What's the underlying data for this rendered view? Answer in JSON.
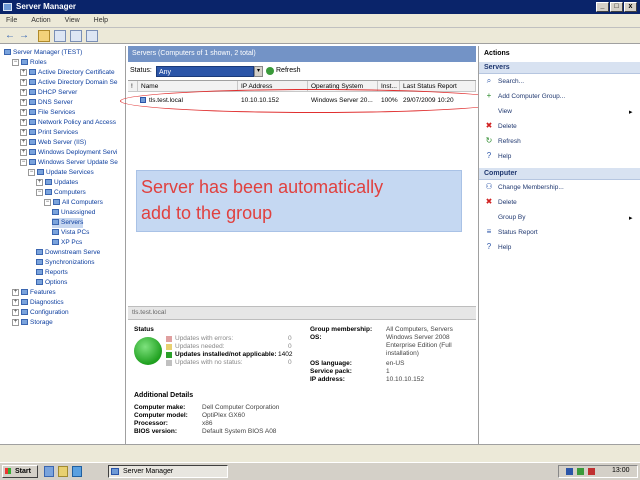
{
  "window": {
    "title": "Server Manager",
    "min": "_",
    "max": "□",
    "close": "x"
  },
  "menu": [
    "File",
    "Action",
    "View",
    "Help"
  ],
  "toolbar": {
    "back": "←",
    "forward": "→"
  },
  "tree": [
    {
      "label": "Server Manager (TEST)",
      "indent": 0,
      "exp": "",
      "icon": true
    },
    {
      "label": "Roles",
      "indent": 1,
      "exp": "−"
    },
    {
      "label": "Active Directory Certificate",
      "indent": 2,
      "exp": "+"
    },
    {
      "label": "Active Directory Domain Se",
      "indent": 2,
      "exp": "+"
    },
    {
      "label": "DHCP Server",
      "indent": 2,
      "exp": "+"
    },
    {
      "label": "DNS Server",
      "indent": 2,
      "exp": "+"
    },
    {
      "label": "File Services",
      "indent": 2,
      "exp": "+"
    },
    {
      "label": "Network Policy and Access",
      "indent": 2,
      "exp": "+"
    },
    {
      "label": "Print Services",
      "indent": 2,
      "exp": "+"
    },
    {
      "label": "Web Server (IIS)",
      "indent": 2,
      "exp": "+"
    },
    {
      "label": "Windows Deployment Servi",
      "indent": 2,
      "exp": "+"
    },
    {
      "label": "Windows Server Update Se",
      "indent": 2,
      "exp": "−"
    },
    {
      "label": "Update Services",
      "indent": 3,
      "exp": "−"
    },
    {
      "label": "Updates",
      "indent": 4,
      "exp": "+"
    },
    {
      "label": "Computers",
      "indent": 4,
      "exp": "−"
    },
    {
      "label": "All Computers",
      "indent": 5,
      "exp": "−"
    },
    {
      "label": "Unassigned",
      "indent": 6,
      "exp": ""
    },
    {
      "label": "Servers",
      "indent": 6,
      "exp": "",
      "sel": true
    },
    {
      "label": "Vista PCs",
      "indent": 6,
      "exp": ""
    },
    {
      "label": "XP Pcs",
      "indent": 6,
      "exp": ""
    },
    {
      "label": "Downstream Serve",
      "indent": 4,
      "exp": ""
    },
    {
      "label": "Synchronizations",
      "indent": 4,
      "exp": ""
    },
    {
      "label": "Reports",
      "indent": 4,
      "exp": ""
    },
    {
      "label": "Options",
      "indent": 4,
      "exp": ""
    },
    {
      "label": "Features",
      "indent": 1,
      "exp": "+"
    },
    {
      "label": "Diagnostics",
      "indent": 1,
      "exp": "+"
    },
    {
      "label": "Configuration",
      "indent": 1,
      "exp": "+"
    },
    {
      "label": "Storage",
      "indent": 1,
      "exp": "+"
    }
  ],
  "center": {
    "header": "Servers (Computers of 1 shown, 2 total)",
    "status_label": "Status:",
    "status_value": "Any",
    "refresh": "Refresh",
    "columns": [
      "!",
      "Name",
      "IP Address",
      "Operating System",
      "Inst...",
      "Last Status Report"
    ],
    "row": [
      "",
      "tls.test.local",
      "10.10.10.152",
      "Windows Server 20...",
      "100%",
      "29/07/2009 10:20"
    ]
  },
  "callout": {
    "line1": "Server has been automatically",
    "line2": "add to the group"
  },
  "details": {
    "heading": "tls.test.local",
    "status_title": "Status",
    "status_items": [
      {
        "label": "Updates with errors:",
        "value": "0"
      },
      {
        "label": "Updates needed:",
        "value": "0"
      },
      {
        "label": "Updates installed/not applicable:",
        "value": "1402"
      },
      {
        "label": "Updates with no status:",
        "value": "0"
      }
    ],
    "group_label": "Group membership:",
    "group_value": "All Computers, Servers",
    "os_label": "OS:",
    "os_value": [
      "Windows Server 2008",
      "Enterprise Edition (Full",
      "installation)"
    ],
    "lang_label": "OS language:",
    "lang_value": "en-US",
    "sp_label": "Service pack:",
    "sp_value": "1",
    "ip_label": "IP address:",
    "ip_value": "10.10.10.152",
    "additional_title": "Additional Details",
    "make_label": "Computer make:",
    "make_value": "Dell Computer Corporation",
    "model_label": "Computer model:",
    "model_value": "OptiPlex GX60",
    "proc_label": "Processor:",
    "proc_value": "x86",
    "bios_label": "BIOS version:",
    "bios_value": "Default System BIOS A08"
  },
  "actions": {
    "title": "Actions",
    "section1": "Servers",
    "items1": [
      {
        "label": "Search...",
        "icon": "search-icon"
      },
      {
        "label": "Add Computer Group...",
        "icon": "add-group-icon"
      },
      {
        "label": "View",
        "icon": "",
        "arrow": "▸"
      },
      {
        "label": "Delete",
        "icon": "delete-icon"
      },
      {
        "label": "Refresh",
        "icon": "refresh-icon"
      },
      {
        "label": "Help",
        "icon": "help-icon"
      }
    ],
    "section2": "Computer",
    "items2": [
      {
        "label": "Change Membership...",
        "icon": "membership-icon"
      },
      {
        "label": "Delete",
        "icon": "delete-icon"
      },
      {
        "label": "Group By",
        "icon": "",
        "arrow": "▸"
      },
      {
        "label": "Status Report",
        "icon": "report-icon"
      },
      {
        "label": "Help",
        "icon": "help-icon"
      }
    ]
  },
  "taskbar": {
    "start": "Start",
    "task": "Server Manager",
    "clock": "13:00"
  },
  "colors": {
    "accent": "#7393c6",
    "title": "#0a246a",
    "callout_text": "#e0413f",
    "callout_bg": "#c5d8f2",
    "ellipse": "#e03030"
  }
}
